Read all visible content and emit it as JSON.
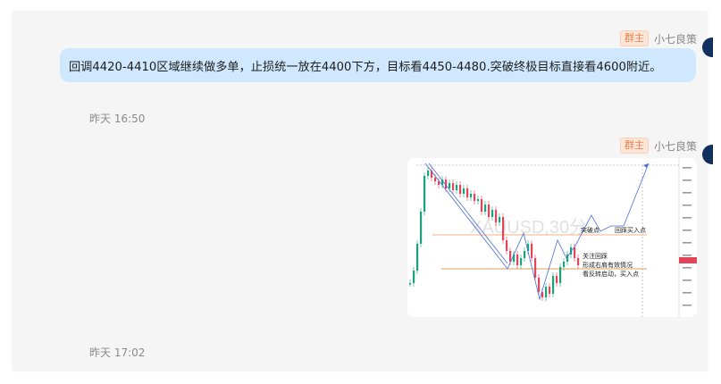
{
  "messages": [
    {
      "role_badge": "群主",
      "sender": "小七良策",
      "text": "回调4420-4410区域继续做多单，止损统一放在4400下方，目标看4450-4480.突破终极目标直接看4600附近。",
      "time": "昨天 16:50"
    },
    {
      "role_badge": "群主",
      "sender": "小七良策",
      "image": {
        "watermark": "XAUUSD,30分",
        "annotations": {
          "breakout": "突破点",
          "pullback_buy": "回踩买入点",
          "note_1": "关注回踩",
          "note_2": "形成右肩有效情况",
          "note_3": "看反转启动，买入点"
        }
      },
      "time": "昨天 17:02"
    }
  ],
  "colors": {
    "bubble": "#cfe8fd",
    "badge_bg": "#fde6d8",
    "badge_text": "#e8804d",
    "avatar": "#12305e",
    "candle_up": "#1aa37a",
    "candle_down": "#e0455a",
    "trendline": "#4a6fd8"
  }
}
